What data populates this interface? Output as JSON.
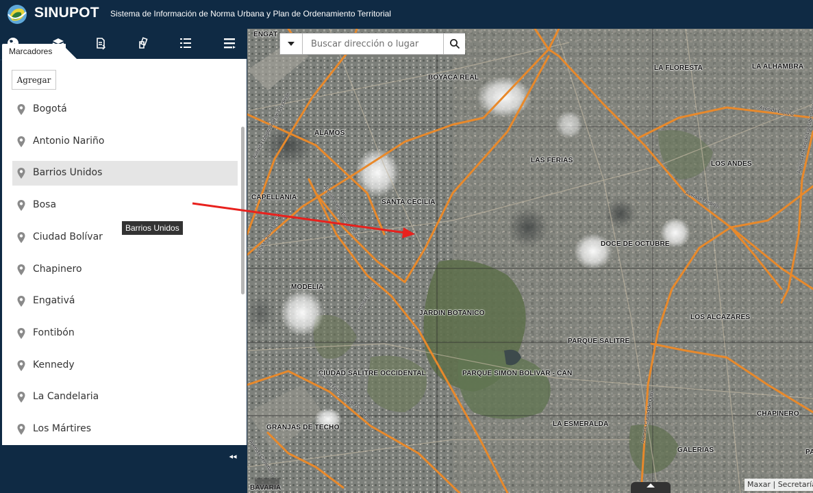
{
  "header": {
    "app_name": "SINUPOT",
    "subtitle": "Sistema de Información de Norma Urbana y Plan de Ordenamiento Territorial"
  },
  "toolbar": {
    "icons": [
      "basemap-icon",
      "layers-icon",
      "document-icon",
      "pages-icon",
      "legend-list-icon",
      "menu-icon"
    ]
  },
  "bookmarks": {
    "tab_label": "Marcadores",
    "add_label": "Agregar",
    "items": [
      {
        "label": "Bogotá"
      },
      {
        "label": "Antonio Nariño"
      },
      {
        "label": "Barrios Unidos"
      },
      {
        "label": "Bosa"
      },
      {
        "label": "Ciudad Bolívar"
      },
      {
        "label": "Chapinero"
      },
      {
        "label": "Engativá"
      },
      {
        "label": "Fontibón"
      },
      {
        "label": "Kennedy"
      },
      {
        "label": "La Candelaria"
      },
      {
        "label": "Los Mártires"
      }
    ],
    "hovered_index": 2,
    "tooltip": "Barrios Unidos"
  },
  "collapse_label": "◂◂",
  "search": {
    "placeholder": "Buscar dirección o lugar"
  },
  "map": {
    "places": [
      {
        "name": "ENGAT"
      },
      {
        "name": "BOYACA REAL"
      },
      {
        "name": "LA FLORESTA"
      },
      {
        "name": "LA ALHAMBRA"
      },
      {
        "name": "ALAMOS"
      },
      {
        "name": "LAS FERIAS"
      },
      {
        "name": "LOS ANDES"
      },
      {
        "name": "CAPELLANIA"
      },
      {
        "name": "SANTA CECILIA"
      },
      {
        "name": "DOCE DE OCTUBRE"
      },
      {
        "name": "MODELIA"
      },
      {
        "name": "JARDIN BOTANICO"
      },
      {
        "name": "LOS ALCAZARES"
      },
      {
        "name": "PARQUE SALITRE"
      },
      {
        "name": "CIUDAD SALITRE OCCIDENTAL"
      },
      {
        "name": "PARQUE SIMON BOLIVAR - CAN"
      },
      {
        "name": "CHAPINERO"
      },
      {
        "name": "GRANJAS DE TECHO"
      },
      {
        "name": "LA ESMERALDA"
      },
      {
        "name": "GALERIAS"
      },
      {
        "name": "BAVARIA"
      },
      {
        "name": "PA"
      }
    ],
    "roads": [
      {
        "name": "Avenida Longitudinal de Occidente"
      },
      {
        "name": "Avenida España"
      },
      {
        "name": "Avenida Paseo de Los Libertadores"
      },
      {
        "name": "Avenida Jorge Eliécer Gaitán"
      },
      {
        "name": "Avenida Ciudad de Cali"
      },
      {
        "name": "Avenida Medellín"
      },
      {
        "name": "Avenida Boyacá"
      },
      {
        "name": "Avenida Ferrocarril de Occidente"
      },
      {
        "name": "Avenida Ciudad de Quito"
      },
      {
        "name": "Avenida Centenario"
      }
    ],
    "attribution": "Maxar | Secretaría",
    "road_color": "#e8892b"
  }
}
